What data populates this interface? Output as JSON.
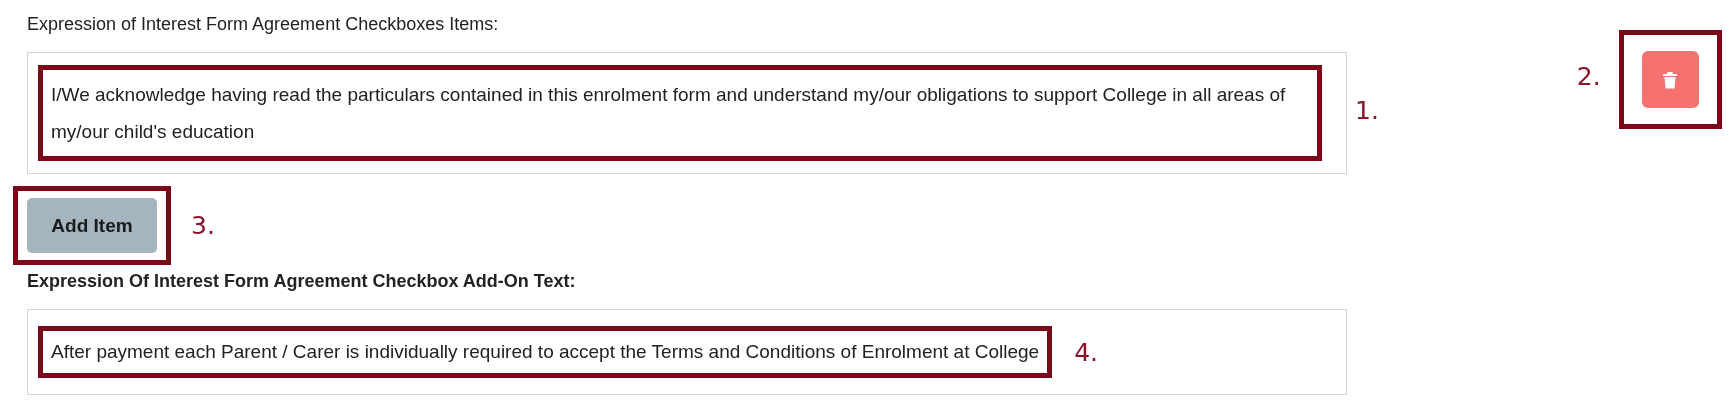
{
  "agreement_items_section": {
    "label": "Expression of Interest Form Agreement Checkboxes Items:",
    "items": [
      {
        "text": "I/We acknowledge having read the particulars contained in this enrolment form and understand my/our obligations to support College in all areas of my/our child's education",
        "highlighted": true,
        "annotation": "1."
      }
    ],
    "delete_button": {
      "highlighted": true,
      "annotation": "2."
    },
    "add_button": {
      "label": "Add Item",
      "highlighted": true,
      "annotation": "3."
    }
  },
  "add_on_section": {
    "label": "Expression Of Interest Form Agreement Checkbox Add-On Text:",
    "text": "After payment each Parent / Carer is individually required to accept the Terms and Conditions of Enrolment at College",
    "highlighted": true,
    "annotation": "4."
  }
}
